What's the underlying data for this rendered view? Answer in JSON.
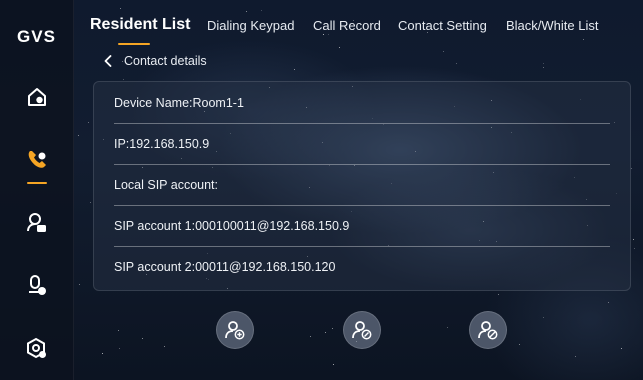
{
  "app": {
    "logo": "GVS"
  },
  "sidebar": {
    "items": [
      {
        "name": "home-icon",
        "active": false
      },
      {
        "name": "phone-icon",
        "active": true
      },
      {
        "name": "user-camera-icon",
        "active": false
      },
      {
        "name": "user-monitor-icon",
        "active": false
      },
      {
        "name": "settings-icon",
        "active": false
      }
    ],
    "accent_color": "#f5a524"
  },
  "tabs": [
    {
      "label": "Resident List",
      "active": true
    },
    {
      "label": "Dialing Keypad",
      "active": false
    },
    {
      "label": "Call Record",
      "active": false
    },
    {
      "label": "Contact Setting",
      "active": false
    },
    {
      "label": "Black/White List",
      "active": false
    }
  ],
  "back": {
    "label": "Contact details"
  },
  "details": [
    "Device Name:Room1-1",
    "IP:192.168.150.9",
    "Local SIP account:",
    "SIP account 1:000100011@192.168.150.9",
    "SIP account 2:00011@192.168.150.120"
  ],
  "actions": [
    {
      "name": "add-contact-icon"
    },
    {
      "name": "edit-contact-icon"
    },
    {
      "name": "block-contact-icon"
    }
  ]
}
